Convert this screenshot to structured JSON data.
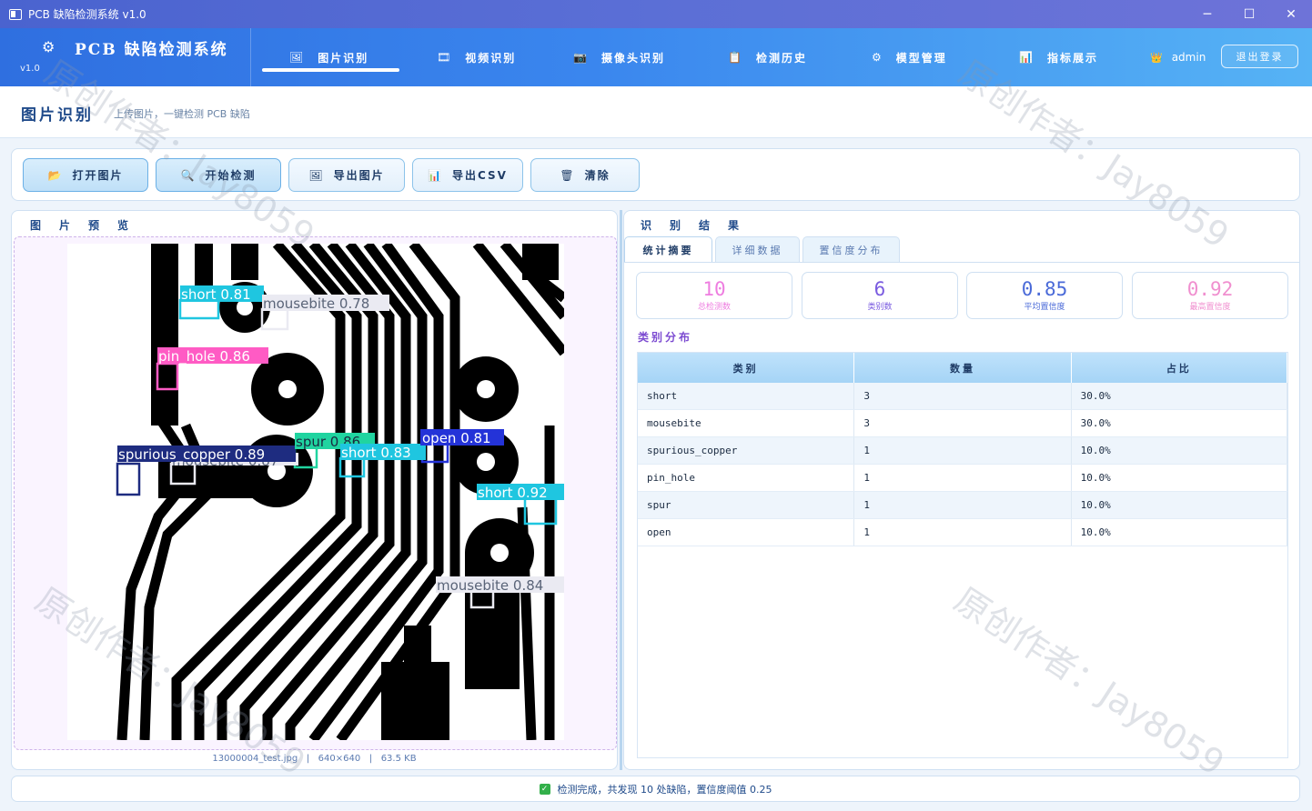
{
  "window": {
    "title": "PCB 缺陷检测系统 v1.0",
    "controls": {
      "minimize": "─",
      "maximize": "☐",
      "close": "✕"
    }
  },
  "header": {
    "brand_name": "PCB 缺陷检测系统",
    "version": "v1.0",
    "nav": [
      {
        "label": "图片识别",
        "icon": "image-icon",
        "glyph": "🖼"
      },
      {
        "label": "视频识别",
        "icon": "video-icon",
        "glyph": "🎞"
      },
      {
        "label": "摄像头识别",
        "icon": "camera-icon",
        "glyph": "📷"
      },
      {
        "label": "检测历史",
        "icon": "history-icon",
        "glyph": "📋"
      },
      {
        "label": "模型管理",
        "icon": "gear-icon",
        "glyph": "⚙"
      },
      {
        "label": "指标展示",
        "icon": "chart-icon",
        "glyph": "📊"
      }
    ],
    "user": "admin",
    "logout_label": "退出登录"
  },
  "page": {
    "title": "图片识别",
    "subtitle": "上传图片，一键检测 PCB 缺陷"
  },
  "toolbar": [
    {
      "label": "打开图片",
      "icon": "folder-icon",
      "glyph": "📂"
    },
    {
      "label": "开始检测",
      "icon": "search-icon",
      "glyph": "🔍"
    },
    {
      "label": "导出图片",
      "icon": "image-export-icon",
      "glyph": "🖼"
    },
    {
      "label": "导出CSV",
      "icon": "csv-icon",
      "glyph": "📊"
    },
    {
      "label": "清除",
      "icon": "trash-icon",
      "glyph": "🗑"
    }
  ],
  "preview": {
    "title": "图片预览",
    "file_name": "13000004_test.jpg",
    "resolution": "640×640",
    "file_size": "63.5 KB",
    "detections": [
      {
        "label": "short 0.81",
        "color": "#1fc6e0"
      },
      {
        "label": "mousebite 0.78",
        "color": "#eaeaf2"
      },
      {
        "label": "pin_hole 0.86",
        "color": "#ff5bc4"
      },
      {
        "label": "spurious_copper 0.89",
        "color": "#1e2c80"
      },
      {
        "label": "mousebite 0.87",
        "color": "#eaeaf2"
      },
      {
        "label": "spur 0.86",
        "color": "#20d4a0"
      },
      {
        "label": "short 0.83",
        "color": "#1fc6e0"
      },
      {
        "label": "open 0.81",
        "color": "#2433d8"
      },
      {
        "label": "short 0.92",
        "color": "#1fc6e0"
      },
      {
        "label": "mousebite 0.84",
        "color": "#eaeaf2"
      }
    ]
  },
  "results": {
    "title": "识别结果",
    "tabs": [
      "统计摘要",
      "详细数据",
      "置信度分布"
    ],
    "stats": [
      {
        "value": "10",
        "label": "总检测数",
        "color": "#ee7de0"
      },
      {
        "value": "6",
        "label": "类别数",
        "color": "#7a5be0"
      },
      {
        "value": "0.85",
        "label": "平均置信度",
        "color": "#4a6ad8"
      },
      {
        "value": "0.92",
        "label": "最高置信度",
        "color": "#f08fcf"
      }
    ],
    "section_title": "类别分布",
    "columns": [
      "类别",
      "数量",
      "占比"
    ],
    "rows": [
      [
        "short",
        "3",
        "30.0%"
      ],
      [
        "mousebite",
        "3",
        "30.0%"
      ],
      [
        "spurious_copper",
        "1",
        "10.0%"
      ],
      [
        "pin_hole",
        "1",
        "10.0%"
      ],
      [
        "spur",
        "1",
        "10.0%"
      ],
      [
        "open",
        "1",
        "10.0%"
      ]
    ]
  },
  "status": "检测完成，共发现 10 处缺陷，置信度阈值 0.25",
  "watermark": "原创作者：Jay8059"
}
